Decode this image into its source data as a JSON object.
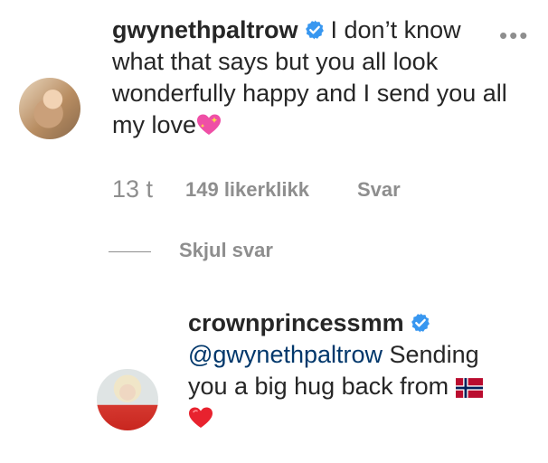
{
  "comment1": {
    "username": "gwynethpaltrow",
    "text_line1": "I don’t know",
    "text_rest": "what that says but you all look wonderfully happy and I send you all my love",
    "emoji": "sparkling-heart-icon"
  },
  "meta": {
    "time": "13 t",
    "likes": "149 likerklikk",
    "reply": "Svar"
  },
  "hide_replies": "Skjul svar",
  "comment2": {
    "username": "crownprincessmm",
    "mention": "@gwynethpaltrow",
    "text": " Sending you a big hug back from ",
    "flag": "norway-flag-icon",
    "heart": "red-heart-icon"
  },
  "more_label": "•••",
  "colors": {
    "text": "#262626",
    "muted": "#8e8e8e",
    "verified": "#3897f0",
    "mention": "#00376b"
  }
}
